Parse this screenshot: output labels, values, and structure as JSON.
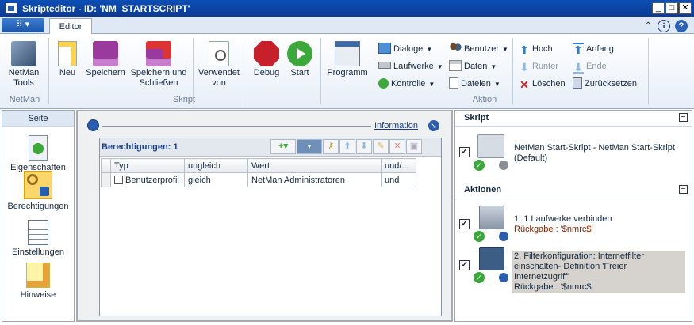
{
  "window": {
    "title": "Skripteditor - ID: 'NM_STARTSCRIPT'"
  },
  "menu": {
    "app_glyph": "⠿ ▾"
  },
  "tabs": [
    {
      "label": "Editor"
    }
  ],
  "ribbon": {
    "groups": {
      "netman": "NetMan",
      "skript": "Skript",
      "aktion": "Aktion"
    },
    "buttons": {
      "netman_tools": "NetMan Tools",
      "neu": "Neu",
      "speichern": "Speichern",
      "speichern_schliessen": "Speichern und Schließen",
      "verwendet_von": "Verwendet von",
      "debug": "Debug",
      "start": "Start",
      "programm": "Programm"
    },
    "small": {
      "dialoge": "Dialoge",
      "laufwerke": "Laufwerke",
      "kontrolle": "Kontrolle",
      "benutzer": "Benutzer",
      "daten": "Daten",
      "dateien": "Dateien",
      "hoch": "Hoch",
      "runter": "Runter",
      "loeschen": "Löschen",
      "anfang": "Anfang",
      "ende": "Ende",
      "zuruecksetzen": "Zurücksetzen"
    }
  },
  "sidebar": {
    "header": "Seite",
    "items": [
      "Eigenschaften",
      "Berechtigungen",
      "Einstellungen",
      "Hinweise"
    ]
  },
  "main": {
    "info_link": "Information",
    "grid_title": "Berechtigungen: 1",
    "columns": [
      "Typ",
      "ungleich",
      "Wert",
      "und/..."
    ],
    "rows": [
      {
        "typ": "Benutzerprofil",
        "ungleich": "gleich",
        "wert": "NetMan Administratoren",
        "und": "und"
      }
    ]
  },
  "right": {
    "skript_header": "Skript",
    "skript_item": "NetMan Start-Skript - NetMan Start-Skript (Default)",
    "aktionen_header": "Aktionen",
    "actions": [
      {
        "line1": "1. 1 Laufwerke verbinden",
        "line2": "Rückgabe : '$nmrc$'"
      },
      {
        "line1": "2. Filterkonfiguration: Internetfilter einschalten- Definition 'Freier Internetzugriff'",
        "line2": "Rückgabe : '$nmrc$'"
      }
    ]
  },
  "colors": {
    "titlebar": "#0b3f9e",
    "ribbon": "#e7eef8",
    "link": "#1a3f8c",
    "rueckgabe": "#8b2500",
    "selected": "#d6d3ce"
  }
}
